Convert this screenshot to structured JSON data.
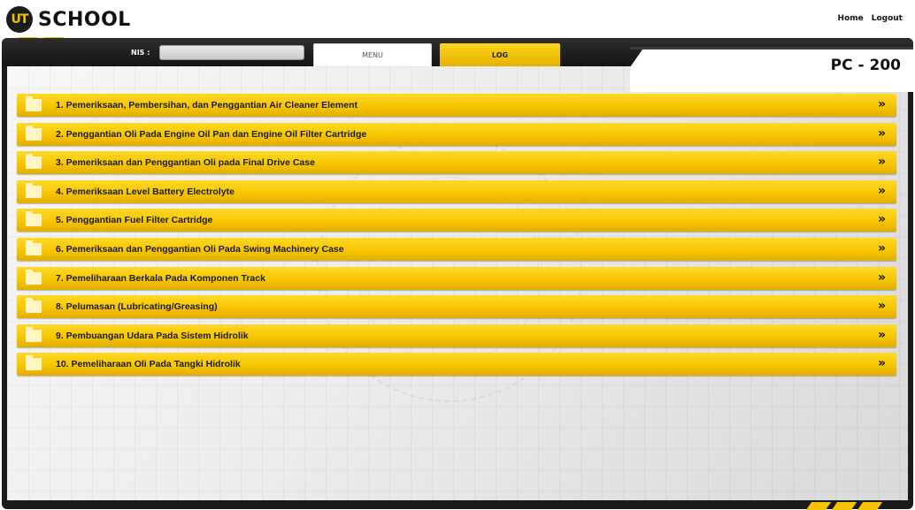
{
  "header": {
    "logo_badge": "UT",
    "logo_text": "SCHOOL",
    "links": {
      "home": "Home",
      "logout": "Logout"
    }
  },
  "toolbar": {
    "nis_label": "NIS :",
    "nis_value": "",
    "tab_menu": "MENU",
    "tab_log": "LOG"
  },
  "model": "PC - 200",
  "arrow_glyph": "»",
  "items": [
    {
      "label": "1. Pemeriksaan, Pembersihan, dan Penggantian Air Cleaner Element"
    },
    {
      "label": "2. Penggantian Oli Pada Engine Oil Pan dan Engine Oil Filter Cartridge"
    },
    {
      "label": "3. Pemeriksaan dan Penggantian Oli pada Final Drive Case"
    },
    {
      "label": "4. Pemeriksaan Level Battery Electrolyte"
    },
    {
      "label": "5. Penggantian Fuel Filter Cartridge"
    },
    {
      "label": "6. Pemeriksaan dan Penggantian Oli Pada Swing Machinery Case"
    },
    {
      "label": "7. Pemeliharaan Berkala Pada Komponen Track"
    },
    {
      "label": "8. Pelumasan (Lubricating/Greasing)"
    },
    {
      "label": "9. Pembuangan Udara Pada Sistem Hidrolik"
    },
    {
      "label": "10. Pemeliharaan Oli Pada Tangki Hidrolik"
    }
  ],
  "colors": {
    "accent": "#f7c600",
    "frame": "#1b1b1b"
  }
}
